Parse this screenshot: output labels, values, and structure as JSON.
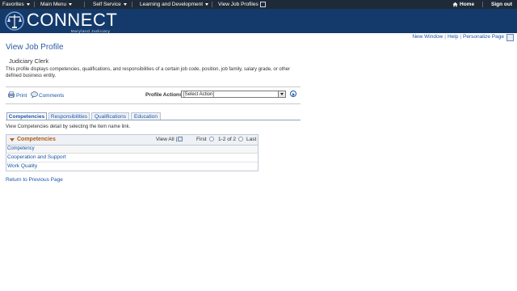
{
  "topnav": {
    "favorites": "Favorites",
    "main_menu": "Main Menu",
    "self_service": "Self Service",
    "learning": "Learning and Development",
    "current": "View Job Profiles",
    "home": "Home",
    "signout": "Sign out"
  },
  "banner": {
    "brand": "CONNECT",
    "sub": "Maryland Judiciary"
  },
  "util": {
    "new_window": "New Window",
    "help": "Help",
    "personalize": "Personalize Page"
  },
  "page": {
    "title": "View Job Profile",
    "job_title": "Judiciary Clerk",
    "description": "This profile displays competencies, qualifications, and responsibilities of a certain job code, position, job family, salary grade, or other defined business entity."
  },
  "toolbar": {
    "print": "Print",
    "comments": "Comments",
    "profile_actions_label": "Profile Actions",
    "profile_actions_value": "[Select Action]"
  },
  "tabs": [
    {
      "label": "Competencies"
    },
    {
      "label": "Responsibilities"
    },
    {
      "label": "Qualifications"
    },
    {
      "label": "Education"
    }
  ],
  "instruction": "View Competencies detail by selecting the item name link.",
  "grid": {
    "title": "Competencies",
    "view_all": "View All",
    "first": "First",
    "range": "1-2 of 2",
    "last": "Last",
    "column": "Competency",
    "rows": [
      "Cooperation and Support",
      "Work Quality"
    ]
  },
  "return_link": "Return to Previous Page",
  "colors": {
    "nav_bg": "#1f2a38",
    "banner_bg": "#143a6b",
    "link": "#1a56a8",
    "grid_title": "#b65c16"
  }
}
